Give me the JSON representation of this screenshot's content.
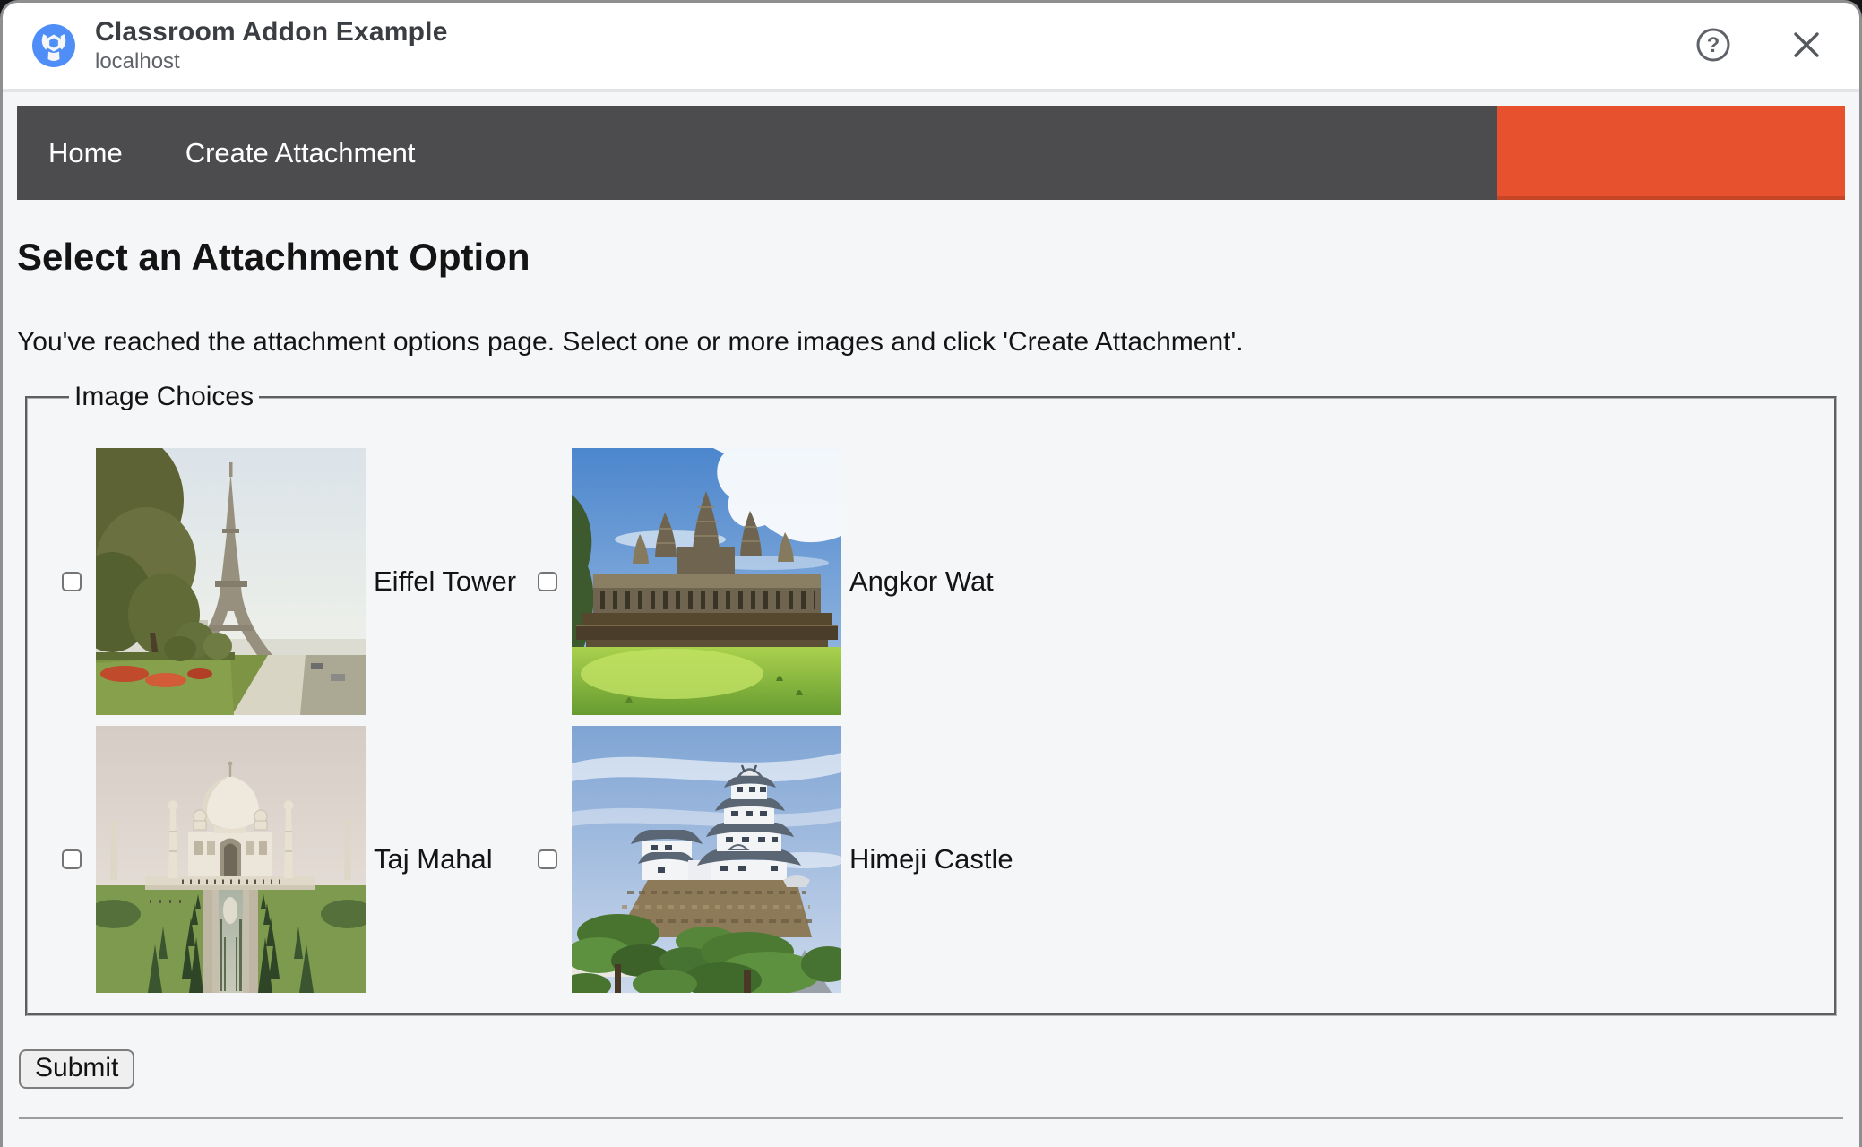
{
  "window": {
    "title": "Classroom Addon Example",
    "subtitle": "localhost",
    "icons": {
      "logo": "addon-wrench-nut-logo",
      "help": "help-question-circle",
      "close": "close-x"
    }
  },
  "navbar": {
    "items": [
      {
        "label": "Home"
      },
      {
        "label": "Create Attachment"
      }
    ],
    "accent_color": "#e8512e"
  },
  "main": {
    "heading": "Select an Attachment Option",
    "description": "You've reached the attachment options page. Select one or more images and click 'Create Attachment'.",
    "fieldset_legend": "Image Choices",
    "choices": [
      {
        "label": "Eiffel Tower",
        "image": "eiffel-tower-photo",
        "checked": false
      },
      {
        "label": "Angkor Wat",
        "image": "angkor-wat-photo",
        "checked": false
      },
      {
        "label": "Taj Mahal",
        "image": "taj-mahal-photo",
        "checked": false
      },
      {
        "label": "Himeji Castle",
        "image": "himeji-castle-photo",
        "checked": false
      }
    ],
    "submit_label": "Submit"
  },
  "colors": {
    "navbar_bg": "#4c4c4e",
    "accent_orange": "#e8512e",
    "page_bg": "#f5f6f8",
    "header_bg": "#ffffff",
    "logo_blue": "#4e8ef6",
    "text_primary": "#141414",
    "text_secondary": "#5f6368"
  }
}
